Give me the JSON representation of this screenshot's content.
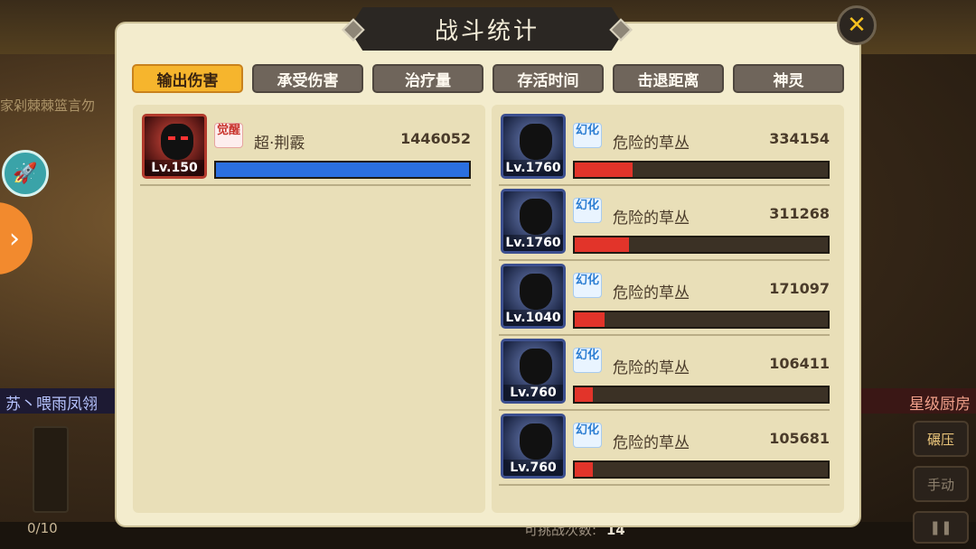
{
  "title": "战斗统计",
  "close_icon": "close-x-icon",
  "tabs": [
    {
      "label": "输出伤害",
      "active": true
    },
    {
      "label": "承受伤害",
      "active": false
    },
    {
      "label": "治疗量",
      "active": false
    },
    {
      "label": "存活时间",
      "active": false
    },
    {
      "label": "击退距离",
      "active": false
    },
    {
      "label": "神灵",
      "active": false
    }
  ],
  "left_team": [
    {
      "level": "Lv.150",
      "badge": "觉醒",
      "name": "超·荆霰",
      "value": "1446052",
      "progress": 1.0
    }
  ],
  "right_team": [
    {
      "level": "Lv.1760",
      "badge": "幻化",
      "name": "危险的草丛",
      "value": "334154",
      "progress": 0.23
    },
    {
      "level": "Lv.1760",
      "badge": "幻化",
      "name": "危险的草丛",
      "value": "311268",
      "progress": 0.215
    },
    {
      "level": "Lv.1040",
      "badge": "幻化",
      "name": "危险的草丛",
      "value": "171097",
      "progress": 0.118
    },
    {
      "level": "Lv.760",
      "badge": "幻化",
      "name": "危险的草丛",
      "value": "106411",
      "progress": 0.073
    },
    {
      "level": "Lv.760",
      "badge": "幻化",
      "name": "危险的草丛",
      "value": "105681",
      "progress": 0.073
    }
  ],
  "background": {
    "left_player_name": "苏丶喂雨凤翎",
    "right_player_name": "星级厨房",
    "left_scroll_text": "家剁棘棘篮言勿",
    "attempts_label": "可挑战次数:",
    "attempts_value": "14",
    "energy": "0/10",
    "right_buttons": [
      "碾压",
      "手动"
    ]
  },
  "colors": {
    "accent_tab": "#f6b52d",
    "enemy_bar": "#e2342a",
    "player_bar": "#2b6fe0",
    "panel_bg": "#f3eccd"
  }
}
